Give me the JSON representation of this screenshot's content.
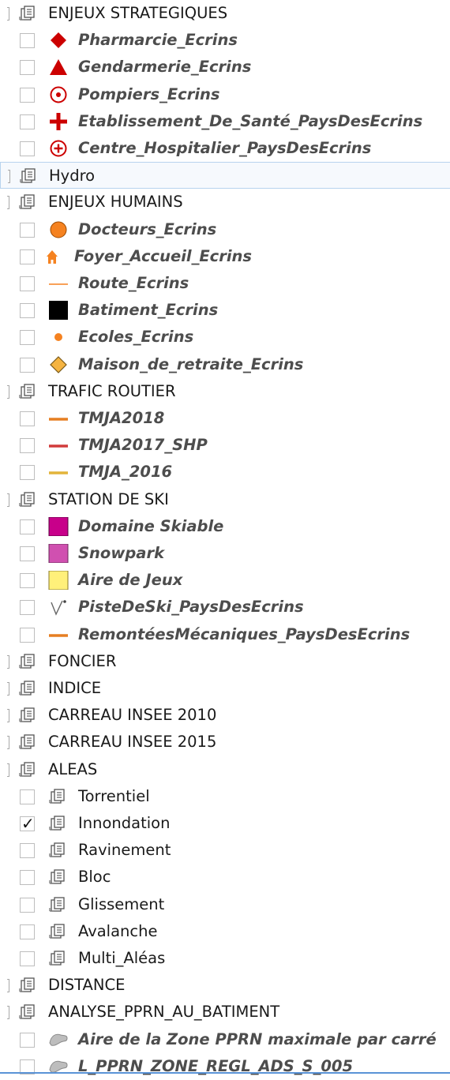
{
  "tree": {
    "rows": [
      {
        "label": "ENJEUX STRATEGIQUES",
        "kind": "group",
        "level": 0,
        "icon": "layer-group-icon"
      },
      {
        "label": "Pharmarcie_Ecrins",
        "kind": "layer",
        "level": 1,
        "icon": "red-diamond-icon",
        "checked": false
      },
      {
        "label": "Gendarmerie_Ecrins",
        "kind": "layer",
        "level": 1,
        "icon": "red-triangle-icon",
        "checked": false
      },
      {
        "label": "Pompiers_Ecrins",
        "kind": "layer",
        "level": 1,
        "icon": "red-target-circle-icon",
        "checked": false
      },
      {
        "label": "Etablissement_De_Santé_PaysDesEcrins",
        "kind": "layer",
        "level": 1,
        "icon": "red-cross-icon",
        "checked": false
      },
      {
        "label": "Centre_Hospitalier_PaysDesEcrins",
        "kind": "layer",
        "level": 1,
        "icon": "red-circled-plus-icon",
        "checked": false
      },
      {
        "label": "Hydro",
        "kind": "group",
        "level": 0,
        "icon": "layer-group-icon",
        "highlighted": true
      },
      {
        "label": "ENJEUX HUMAINS",
        "kind": "group",
        "level": 0,
        "icon": "layer-group-icon"
      },
      {
        "label": "Docteurs_Ecrins",
        "kind": "layer",
        "level": 1,
        "icon": "orange-circle-icon",
        "checked": false
      },
      {
        "label": "Foyer_Accueil_Ecrins",
        "kind": "layer",
        "level": 1,
        "icon": "orange-house-icon",
        "checked": false
      },
      {
        "label": "Route_Ecrins",
        "kind": "layer",
        "level": 1,
        "icon": "orange-thin-line-icon",
        "checked": false
      },
      {
        "label": "Batiment_Ecrins",
        "kind": "layer",
        "level": 1,
        "icon": "black-square-icon",
        "checked": false
      },
      {
        "label": "Ecoles_Ecrins",
        "kind": "layer",
        "level": 1,
        "icon": "orange-dot-icon",
        "checked": false
      },
      {
        "label": "Maison_de_retraite_Ecrins",
        "kind": "layer",
        "level": 1,
        "icon": "orange-diamond-icon",
        "checked": false
      },
      {
        "label": "TRAFIC ROUTIER",
        "kind": "group",
        "level": 0,
        "icon": "layer-group-icon"
      },
      {
        "label": "TMJA2018",
        "kind": "layer",
        "level": 1,
        "icon": "orange-line-icon",
        "checked": false
      },
      {
        "label": "TMJA2017_SHP",
        "kind": "layer",
        "level": 1,
        "icon": "red-line-icon",
        "checked": false
      },
      {
        "label": "TMJA_2016",
        "kind": "layer",
        "level": 1,
        "icon": "yellow-line-icon",
        "checked": false
      },
      {
        "label": "STATION DE SKI",
        "kind": "group",
        "level": 0,
        "icon": "layer-group-icon"
      },
      {
        "label": "Domaine Skiable",
        "kind": "layer",
        "level": 1,
        "icon": "magenta-square-icon",
        "checked": false
      },
      {
        "label": "Snowpark",
        "kind": "layer",
        "level": 1,
        "icon": "pink-square-icon",
        "checked": false
      },
      {
        "label": "Aire de Jeux",
        "kind": "layer",
        "level": 1,
        "icon": "yellow-square-icon",
        "checked": false
      },
      {
        "label": "PisteDeSki_PaysDesEcrins",
        "kind": "layer",
        "level": 1,
        "icon": "line-style-icon",
        "checked": false
      },
      {
        "label": "RemontéesMécaniques_PaysDesEcrins",
        "kind": "layer",
        "level": 1,
        "icon": "orange-line-icon",
        "checked": false
      },
      {
        "label": "FONCIER",
        "kind": "group",
        "level": 0,
        "icon": "layer-group-icon"
      },
      {
        "label": "INDICE",
        "kind": "group",
        "level": 0,
        "icon": "layer-group-icon"
      },
      {
        "label": "CARREAU INSEE 2010",
        "kind": "group",
        "level": 0,
        "icon": "layer-group-icon"
      },
      {
        "label": "CARREAU INSEE 2015",
        "kind": "group",
        "level": 0,
        "icon": "layer-group-icon"
      },
      {
        "label": "ALEAS",
        "kind": "group",
        "level": 0,
        "icon": "layer-group-icon"
      },
      {
        "label": "Torrentiel",
        "kind": "subgroup",
        "level": 1,
        "icon": "layer-group-icon",
        "checked": false
      },
      {
        "label": "Innondation",
        "kind": "subgroup",
        "level": 1,
        "icon": "layer-group-icon",
        "checked": true
      },
      {
        "label": "Ravinement",
        "kind": "subgroup",
        "level": 1,
        "icon": "layer-group-icon",
        "checked": false
      },
      {
        "label": "Bloc",
        "kind": "subgroup",
        "level": 1,
        "icon": "layer-group-icon",
        "checked": false
      },
      {
        "label": "Glissement",
        "kind": "subgroup",
        "level": 1,
        "icon": "layer-group-icon",
        "checked": false
      },
      {
        "label": "Avalanche",
        "kind": "subgroup",
        "level": 1,
        "icon": "layer-group-icon",
        "checked": false
      },
      {
        "label": "Multi_Aléas",
        "kind": "subgroup",
        "level": 1,
        "icon": "layer-group-icon",
        "checked": false
      },
      {
        "label": "DISTANCE",
        "kind": "group",
        "level": 0,
        "icon": "layer-group-icon"
      },
      {
        "label": "ANALYSE_PPRN_AU_BATIMENT",
        "kind": "group",
        "level": 0,
        "icon": "layer-group-icon"
      },
      {
        "label": "Aire de la Zone PPRN maximale par carré",
        "kind": "layer",
        "level": 1,
        "icon": "grey-polygon-icon",
        "checked": false
      },
      {
        "label": "L_PPRN_ZONE_REGL_ADS_S_005",
        "kind": "layer",
        "level": 1,
        "icon": "grey-polygon-icon",
        "checked": false
      }
    ],
    "colors": {
      "red": "#cc0000",
      "orange": "#f58220",
      "dark_orange": "#e67e22",
      "magenta": "#c8008a",
      "pink": "#d050b0",
      "yellow_fill": "#fff07a",
      "yellow_line": "#e2b43a",
      "line_red": "#d13b3b",
      "grey_polygon": "#bdbdbd",
      "layer_label": "#4d4d4d",
      "highlight_border": "#b8d3ee"
    }
  }
}
